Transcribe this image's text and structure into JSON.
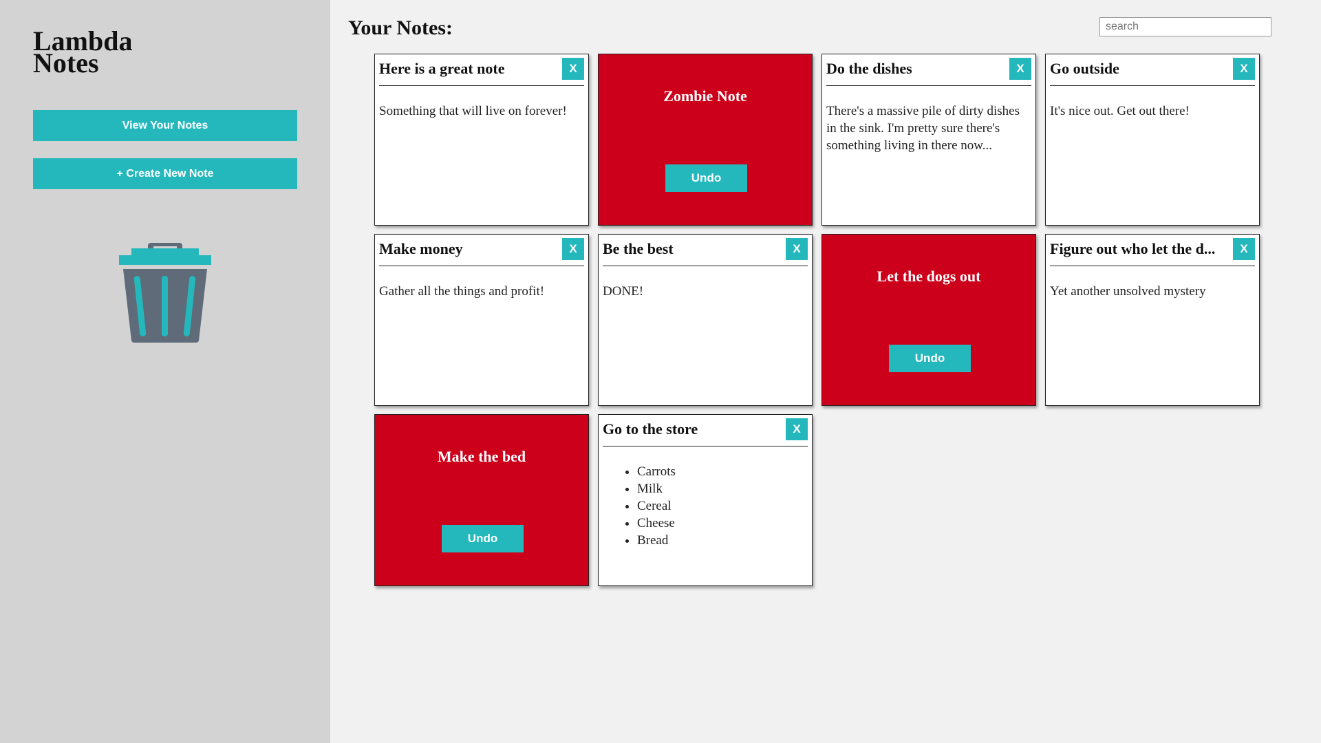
{
  "sidebar": {
    "app_title_line1": "Lambda",
    "app_title_line2": "Notes",
    "view_notes_label": "View Your Notes",
    "create_note_label": "+ Create New Note"
  },
  "header": {
    "title": "Your Notes:",
    "search_placeholder": "search"
  },
  "colors": {
    "accent": "#24b8bd",
    "deleted_card": "#cc001a",
    "sidebar_bg": "#d3d3d3",
    "page_bg": "#f1f1f1",
    "trash_body": "#5f6b78"
  },
  "icons": {
    "trash": "trash-can-icon",
    "delete": "X"
  },
  "notes": [
    {
      "title": "Here is a great note",
      "body": "Something that will live on forever!",
      "delete_label": "X"
    },
    {
      "title": "Zombie Note",
      "deleted": true,
      "undo_label": "Undo"
    },
    {
      "title": "Do the dishes",
      "body": "There's a massive pile of dirty dishes in the sink. I'm pretty sure there's something living in there now...",
      "delete_label": "X"
    },
    {
      "title": "Go outside",
      "body": "It's nice out. Get out there!",
      "delete_label": "X"
    },
    {
      "title": "Make money",
      "body": "Gather all the things and profit!",
      "delete_label": "X"
    },
    {
      "title": "Be the best",
      "body": "DONE!",
      "delete_label": "X"
    },
    {
      "title": "Let the dogs out",
      "deleted": true,
      "undo_label": "Undo"
    },
    {
      "title": "Figure out who let the d...",
      "body": "Yet another unsolved mystery",
      "delete_label": "X"
    },
    {
      "title": "Make the bed",
      "deleted": true,
      "undo_label": "Undo"
    },
    {
      "title": "Go to the store",
      "list": [
        "Carrots",
        "Milk",
        "Cereal",
        "Cheese",
        "Bread"
      ],
      "delete_label": "X"
    }
  ]
}
